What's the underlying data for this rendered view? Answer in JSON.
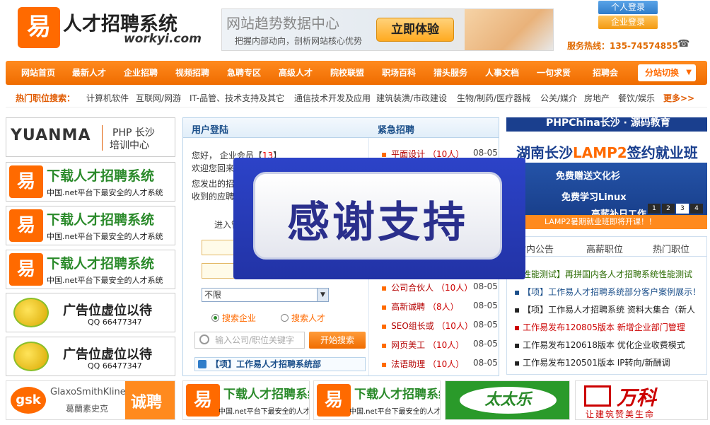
{
  "header": {
    "logo_mark": "易",
    "logo_title": "人才招聘系统",
    "logo_domain": "workyi.com",
    "banner_title": "网站趋势数据中心",
    "banner_sub": "把握内部动向，剖析网站核心优势",
    "banner_button": "立即体验",
    "personal_login": "个人登录",
    "company_login": "企业登录",
    "hotline": "服务热线：135-74574855"
  },
  "nav": {
    "items": [
      "网站首页",
      "最新人才",
      "企业招聘",
      "视频招聘",
      "急聘专区",
      "高级人才",
      "院校联盟",
      "职场百科",
      "猎头服务",
      "人事文档",
      "一句求贤",
      "招聘会"
    ],
    "switch": "分站切换"
  },
  "hot_jobs": {
    "label": "热门职位搜索：",
    "items": [
      "计算机软件",
      "互联网/网游",
      "IT-品管、技术支持及其它",
      "通信技术开发及应用",
      "建筑装潢/市政建设",
      "生物/制药/医疗器械",
      "公关/媒介",
      "房地产",
      "餐饮/娱乐"
    ],
    "more": "更多>>"
  },
  "left_ads": {
    "yuanma_logo": "YUANMA",
    "yuanma_line1": "PHP 长沙",
    "yuanma_line2": "培训中心",
    "download_title": "下载人才招聘系统",
    "download_sub": "中国.net平台下最安全的人才系统",
    "placeholder_title": "广告位虚位以待",
    "placeholder_qq": "QQ 66477347"
  },
  "login_panel": {
    "title": "用户登陆",
    "hello_prefix": "您好，  企业会员【",
    "hello_num": "13",
    "hello_suffix": "】",
    "welcome": "欢迎您回来",
    "sent": "您发出的招",
    "received": "收到的应聘",
    "enter": "进入管",
    "select_value": "不限",
    "radio_company": "搜索企业",
    "radio_talent": "搜索人才",
    "search_placeholder": "输入公司/职位关键字",
    "search_button": "开始搜索",
    "notice": "【项】工作易人才招聘系统部"
  },
  "urgent": {
    "title": "紧急招聘",
    "jobs": [
      {
        "title": "平面设计",
        "count": "10人",
        "date": "08-05"
      },
      {
        "title": "公司合伙人",
        "count": "10人",
        "date": "08-05"
      },
      {
        "title": "高新诚聘",
        "count": "8人",
        "date": "08-05"
      },
      {
        "title": "SEO组长或",
        "count": "10人",
        "date": "08-05"
      },
      {
        "title": "网页美工",
        "count": "10人",
        "date": "08-05"
      },
      {
        "title": "法语助理",
        "count": "10人",
        "date": "08-05"
      }
    ]
  },
  "overlay": {
    "text": "感谢支持"
  },
  "right_banner": {
    "top": "PHPChina长沙 · 源码教育",
    "headline_prefix": "湖南长沙",
    "headline_highlight": "LAMP2",
    "headline_suffix": "签约就业班",
    "line1": "免费赠送文化衫",
    "line2": "免费学习Linux",
    "line3": "高薪补日工作",
    "pages": [
      "1",
      "2",
      "3",
      "4"
    ],
    "active_page": "3",
    "bottom": "LAMP2暑期就业班即将开课！！"
  },
  "right_tabs": {
    "tabs": [
      "站内公告",
      "高薪职位",
      "热门职位"
    ],
    "news": [
      {
        "text": "【性能测试】再拼国内各人才招聘系统性能测试",
        "style": "green"
      },
      {
        "text": "【项】工作易人才招聘系统部分客户案例展示！",
        "style": "blue"
      },
      {
        "text": "【项】工作易人才招聘系统 资料大集合（新人",
        "style": "plain"
      },
      {
        "text": "工作易发布120805版本 新增企业部门管理",
        "style": "red"
      },
      {
        "text": "工作易发布120618版本 优化企业收费模式",
        "style": "plain"
      },
      {
        "text": "工作易发布120501版本 IP转向/新酬调",
        "style": "plain"
      }
    ]
  },
  "bottom_logos": {
    "gsk_mark": "gsk",
    "gsk_en": "GlaxoSmithKline",
    "gsk_cn": "葛蘭素史克",
    "gsk_cta": "诚聘",
    "ttl": "太太乐",
    "wanke": "万科",
    "wanke_slogan": "让建筑赞美生命"
  },
  "colors": {
    "brand_orange": "#ff6a00",
    "nav_blue": "#1b4f8a",
    "overlay_blue": "#2233a6"
  }
}
